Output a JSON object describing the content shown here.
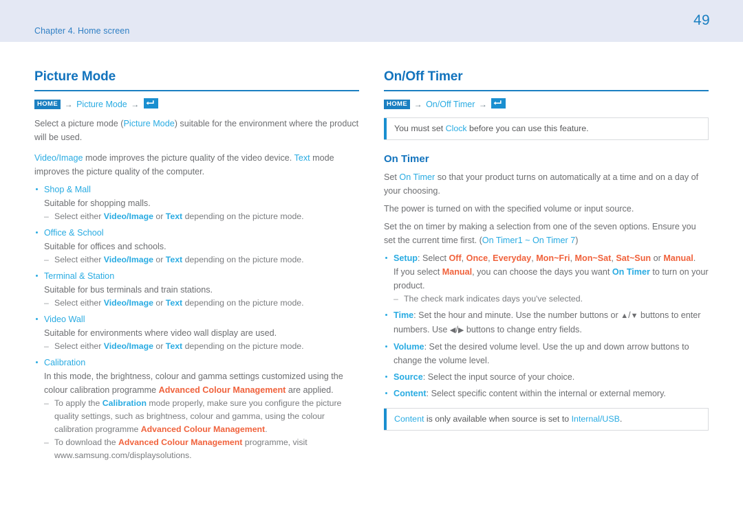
{
  "header": {
    "chapter": "Chapter 4. Home screen",
    "page_number": "49",
    "band_color": "#e4e8f4",
    "accent_color": "#1a7fc1",
    "link_color": "#29abe2",
    "orange_color": "#f0623c"
  },
  "left": {
    "title": "Picture Mode",
    "breadcrumb": {
      "home_label": "HOME",
      "arrow": "→",
      "path_label": "Picture Mode",
      "enter_icon": "enter-key-icon"
    },
    "intro_1_a": "Select a picture mode (",
    "intro_1_hl": "Picture Mode",
    "intro_1_b": ") suitable for the environment where the product will be used.",
    "intro_2_hl1": "Video/Image",
    "intro_2_a": " mode improves the picture quality of the video device. ",
    "intro_2_hl2": "Text",
    "intro_2_b": " mode improves the picture quality of the computer.",
    "sub_note_select_a": "Select either ",
    "sub_note_vi": "Video/Image",
    "sub_note_or": " or ",
    "sub_note_text": "Text",
    "sub_note_b": " depending on the picture mode.",
    "items": [
      {
        "head": "Shop & Mall",
        "body": "Suitable for shopping malls.",
        "has_select_note": true
      },
      {
        "head": "Office & School",
        "body": "Suitable for offices and schools.",
        "has_select_note": true
      },
      {
        "head": "Terminal & Station",
        "body": "Suitable for bus terminals and train stations.",
        "has_select_note": true
      },
      {
        "head": "Video Wall",
        "body": "Suitable for environments where video wall display are used.",
        "has_select_note": true
      }
    ],
    "calibration": {
      "head": "Calibration",
      "body_a": "In this mode, the brightness, colour and gamma settings customized using the colour calibration programme ",
      "body_acm": "Advanced Colour Management",
      "body_b": " are applied.",
      "dash1_a": "To apply the ",
      "dash1_hl": "Calibration",
      "dash1_b": " mode properly, make sure you configure the picture quality settings, such as brightness, colour and gamma, using the colour calibration programme ",
      "dash1_acm": "Advanced Colour Management",
      "dash1_c": ".",
      "dash2_a": "To download the ",
      "dash2_acm": "Advanced Colour Management",
      "dash2_b": " programme, visit www.samsung.com/displaysolutions."
    }
  },
  "right": {
    "title": "On/Off Timer",
    "breadcrumb": {
      "home_label": "HOME",
      "arrow": "→",
      "path_label": "On/Off Timer",
      "enter_icon": "enter-key-icon"
    },
    "note_top": {
      "a": "You must set ",
      "hl": "Clock",
      "b": " before you can use this feature."
    },
    "sub_title": "On Timer",
    "p1_a": "Set ",
    "p1_hl": "On Timer",
    "p1_b": " so that your product turns on automatically at a time and on a day of your choosing.",
    "p2": "The power is turned on with the specified volume or input source.",
    "p3_a": "Set the on timer by making a selection from one of the seven options. Ensure you set the current time first. (",
    "p3_hl1": "On Timer1",
    "p3_tilde": " ~ ",
    "p3_hl2": "On Timer 7",
    "p3_b": ")",
    "setup": {
      "label": "Setup",
      "colon": ": Select ",
      "options": [
        "Off",
        "Once",
        "Everyday",
        "Mon~Fri",
        "Mon~Sat",
        "Sat~Sun"
      ],
      "or": " or ",
      "last_option": "Manual",
      "period": ".",
      "line2_a": "If you select ",
      "line2_manual": "Manual",
      "line2_b": ", you can choose the days you want ",
      "line2_ontimer": "On Timer",
      "line2_c": " to turn on your product.",
      "dash": "The check mark indicates days you've selected."
    },
    "time": {
      "label": "Time",
      "a": ": Set the hour and minute. Use the number buttons or ",
      "up": "▲",
      "slash": "/",
      "down": "▼",
      "b": " buttons to enter numbers. Use ",
      "left": "◀",
      "right": "▶",
      "c": " buttons to change entry fields."
    },
    "volume": {
      "label": "Volume",
      "text": ": Set the desired volume level. Use the up and down arrow buttons to change the volume level."
    },
    "source": {
      "label": "Source",
      "text": ": Select the input source of your choice."
    },
    "content": {
      "label": "Content",
      "text": ": Select specific content within the internal or external memory."
    },
    "note_bottom": {
      "hl1": "Content",
      "a": " is only available when source is set to ",
      "hl2": "Internal/USB",
      "b": "."
    }
  }
}
